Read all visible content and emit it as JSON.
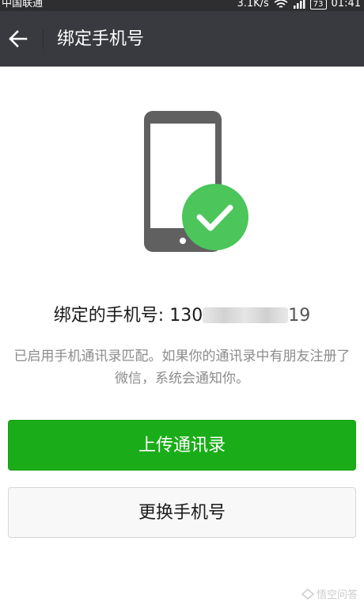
{
  "status_bar": {
    "carrier": "中国联通",
    "speed": "3.1K/s",
    "battery": "73",
    "time": "01:41",
    "icons": [
      "wifi-icon",
      "signal-icon",
      "battery-icon"
    ]
  },
  "nav": {
    "back_icon": "arrow-left-icon",
    "title": "绑定手机号"
  },
  "illustration": {
    "icon": "phone-checkmark-icon",
    "check_color": "#4cc55b",
    "phone_color": "#606060"
  },
  "bound": {
    "label": "绑定的手机号: 130",
    "masked_digits": "19"
  },
  "hint": "已启用手机通讯录匹配。如果你的通讯录中有朋友注册了微信，系统会通知你。",
  "buttons": {
    "upload": "上传通讯录",
    "change": "更换手机号"
  },
  "watermark": {
    "icon": "wukong-logo-icon",
    "text": "悟空问答"
  },
  "colors": {
    "primary_green": "#1aad19",
    "nav_bg": "#393a3f",
    "status_bg": "#2e2e30"
  }
}
